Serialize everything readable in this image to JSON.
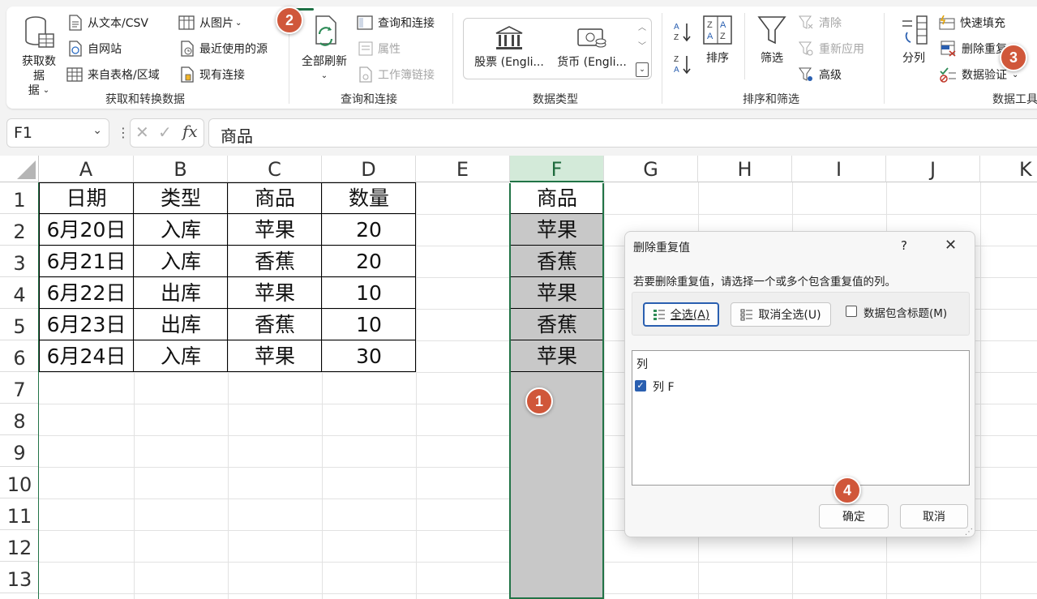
{
  "ribbon": {
    "get_data": "获取数据",
    "get_data_line2": "据",
    "from_text_csv": "从文本/CSV",
    "from_web": "自网站",
    "from_table": "来自表格/区域",
    "from_picture": "从图片",
    "recent_sources": "最近使用的源",
    "existing_connections": "现有连接",
    "group_get_transform": "获取和转换数据",
    "refresh_all": "全部刷新",
    "queries_connections": "查询和连接",
    "properties": "属性",
    "workbook_links": "工作簿链接",
    "group_queries": "查询和连接",
    "stocks": "股票 (Engli...",
    "currencies": "货币 (Engli...",
    "group_data_types": "数据类型",
    "sort": "排序",
    "filter": "筛选",
    "clear": "清除",
    "reapply": "重新应用",
    "advanced": "高级",
    "group_sort_filter": "排序和筛选",
    "text_to_columns": "分列",
    "flash_fill": "快速填充",
    "remove_duplicates": "删除重复",
    "data_validation": "数据验证",
    "group_data_tools": "数据工具"
  },
  "badges": {
    "b1": "1",
    "b2": "2",
    "b3": "3",
    "b4": "4"
  },
  "formula_bar": {
    "name_box": "F1",
    "formula": "商品"
  },
  "columns": [
    "A",
    "B",
    "C",
    "D",
    "E",
    "F",
    "G",
    "H",
    "I",
    "J",
    "K"
  ],
  "rows": [
    "1",
    "2",
    "3",
    "4",
    "5",
    "6",
    "7",
    "8",
    "9",
    "10",
    "11",
    "12",
    "13"
  ],
  "table": {
    "header": [
      "日期",
      "类型",
      "商品",
      "数量"
    ],
    "rows": [
      [
        "6月20日",
        "入库",
        "苹果",
        "20"
      ],
      [
        "6月21日",
        "入库",
        "香蕉",
        "20"
      ],
      [
        "6月22日",
        "出库",
        "苹果",
        "10"
      ],
      [
        "6月23日",
        "出库",
        "香蕉",
        "10"
      ],
      [
        "6月24日",
        "入库",
        "苹果",
        "30"
      ]
    ]
  },
  "col_f": [
    "商品",
    "苹果",
    "香蕉",
    "苹果",
    "香蕉",
    "苹果"
  ],
  "dialog": {
    "title": "删除重复值",
    "help": "?",
    "instruction": "若要删除重复值，请选择一个或多个包含重复值的列。",
    "select_all": "全选(A)",
    "unselect_all": "取消全选(U)",
    "has_headers": "数据包含标题(M)",
    "list_header": "列",
    "list_item": "列 F",
    "ok": "确定",
    "cancel": "取消"
  },
  "colors": {
    "accent": "#217346",
    "badge": "#d0573a",
    "checkbox": "#2a5fb0"
  }
}
